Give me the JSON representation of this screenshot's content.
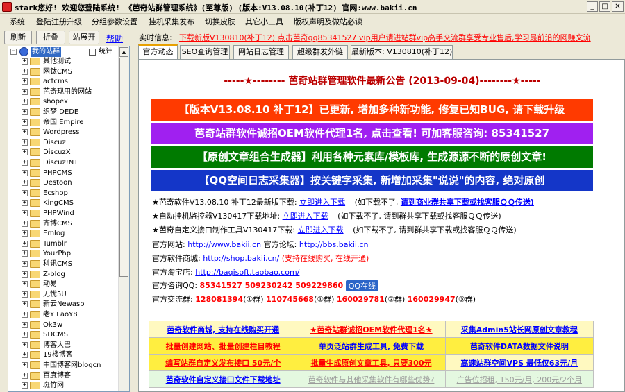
{
  "window": {
    "title": "stark您好! 欢迎您登陆系统! 《芭奇站群管理系统》(至尊版) (版本:V13.08.10(补丁12) 官网:www.bakii.cn"
  },
  "menu": [
    "系统",
    "登陆注册升级",
    "分组参数设置",
    "挂机采集发布",
    "切换皮肤",
    "其它小工具",
    "版权声明及做站必读"
  ],
  "toolbar": {
    "refresh": "刷新",
    "collapse": "折叠",
    "expand": "站展开",
    "help": "帮助"
  },
  "status": {
    "label": "实时信息:",
    "news": "下载新版V130810(补丁12) 点击芭奇qq85341527  vip用户请进站群vip高手交流群享受专业售后,学习最前沿的网赚文流"
  },
  "tree": {
    "root": "我的站群",
    "count_label": "统计",
    "items": [
      "其他测试",
      "网钛CMS",
      "actcms",
      "芭奇现用的网站",
      "shopex",
      "织梦 DEDE",
      "帝国 Empire",
      "Wordpress",
      "Discuz",
      "DiscuzX",
      "Discuz!NT",
      "PHPCMS",
      "Destoon",
      "Ecshop",
      "KingCMS",
      "PHPWind",
      "齐博CMS",
      "Emlog",
      "Tumblr",
      "YourPhp",
      "科讯CMS",
      "Z-blog",
      "动易",
      "无忧5U",
      "新云Newasp",
      "老Y LaoY8",
      "Ok3w",
      "SDCMS",
      "博客大巴",
      "19楼博客",
      "中国博客网blogcn",
      "百度博客",
      "斑竹网"
    ]
  },
  "tabs": [
    "官方动态",
    "SEO查询管理",
    "网站日志管理",
    "超级群发外链",
    "最新版本: V130810(补丁12)"
  ],
  "content": {
    "title": "-----★-------- 芭奇站群管理软件最新公告 (2013-09-04)--------★-----",
    "banners": [
      {
        "text": "【版本V13.08.10 补丁12】已更新, 增加多种新功能, 修复已知BUG, 请下载升级",
        "color": "#ff3a00"
      },
      {
        "text": "芭奇站群软件诚招OEM软件代理1名, 点击查看! 可加客服咨询: 85341527",
        "color": "#a020f0"
      },
      {
        "text": "【原创文章组合生成器】利用各种元素库/模板库, 生成源源不断的原创文章!",
        "color": "#007a00"
      },
      {
        "text": "【QQ空间日志采集器】按关键字采集, 新增加采集\"说说\"的内容, 绝对原创",
        "color": "#1436c8"
      }
    ],
    "downloads": [
      {
        "label": "★芭奇软件V13.08.10 补丁12最新版下载:",
        "link": "立即进入下载",
        "note_plain": "(如下载不了, ",
        "note_bold": "请到商业群共享下载或找客服ＱＱ传送)"
      },
      {
        "label": "★自动挂机监控器V130417下载地址:",
        "link": "立即进入下载",
        "note_plain": "(如下载不了, 请到群共享下载或找客服ＱＱ传送)",
        "note_bold": ""
      },
      {
        "label": "★芭奇自定义接口制作工具V130417下载:",
        "link": "立即进入下载",
        "note_plain": "(如下载不了, 请到群共享下载或找客服ＱＱ传送)",
        "note_bold": ""
      }
    ],
    "site_label": "官方网站:",
    "site_url": "http://www.bakii.cn",
    "forum_label": "官方论坛:",
    "forum_url": "http://bbs.bakii.cn",
    "shop_label": "官方软件商城:",
    "shop_url": "http://shop.bakii.cn/",
    "shop_note": "(支持在线购买, 在线开通)",
    "taobao_label": "官方淘宝店:",
    "taobao_url": "http://baqisoft.taobao.com/",
    "qq_label": "官方咨询QQ:",
    "qq_numbers": "85341527  509230242  509229860",
    "qq_button": "QQ在线",
    "group_label": "官方交流群:",
    "groups": [
      {
        "num": "128081394",
        "tag": "(①群)"
      },
      {
        "num": "110745668",
        "tag": "(①群)"
      },
      {
        "num": "160029781",
        "tag": "(②群)"
      },
      {
        "num": "160029947",
        "tag": "(③群)"
      }
    ]
  },
  "grid": [
    [
      {
        "text": "芭奇软件商城, 支持在线购买开通",
        "bg": "#fff9c0",
        "color": "#00f"
      },
      {
        "text": "★芭奇站群诚招OEM软件代理1名★",
        "bg": "#fff9c0",
        "color": "#f00"
      },
      {
        "text": "采集Admin5站长网原创文章教程",
        "bg": "#fff9c0",
        "color": "#00f"
      }
    ],
    [
      {
        "text": "批量创建网站、批量创建栏目教程",
        "bg": "#ffee40",
        "color": "#f00"
      },
      {
        "text": "单页泛站群生成工具, 免费下载",
        "bg": "#ffee40",
        "color": "#00f"
      },
      {
        "text": "芭奇软件DATA数据文件说明",
        "bg": "#ffee40",
        "color": "#00f"
      }
    ],
    [
      {
        "text": "编写站群自定义发布接口 50元/个",
        "bg": "#ffee40",
        "color": "#f00"
      },
      {
        "text": "批量生成原创文章工具, 只要300元",
        "bg": "#ffee40",
        "color": "#f00"
      },
      {
        "text": "高速站群空间VPS 最低仅63元/月",
        "bg": "#fff9c0",
        "color": "#00f"
      }
    ],
    [
      {
        "text": "芭奇软件自定义接口文件下载地址",
        "bg": "#e4f8e0",
        "color": "#00f"
      },
      {
        "text": "芭奇软件与其他采集软件有哪些优势?",
        "bg": "#e4f8e0",
        "color": "#9c9c9c"
      },
      {
        "text": "广告位招租, 150元/月, 200元/2个月",
        "bg": "#e4f8e0",
        "color": "#9c9c9c"
      }
    ]
  ]
}
